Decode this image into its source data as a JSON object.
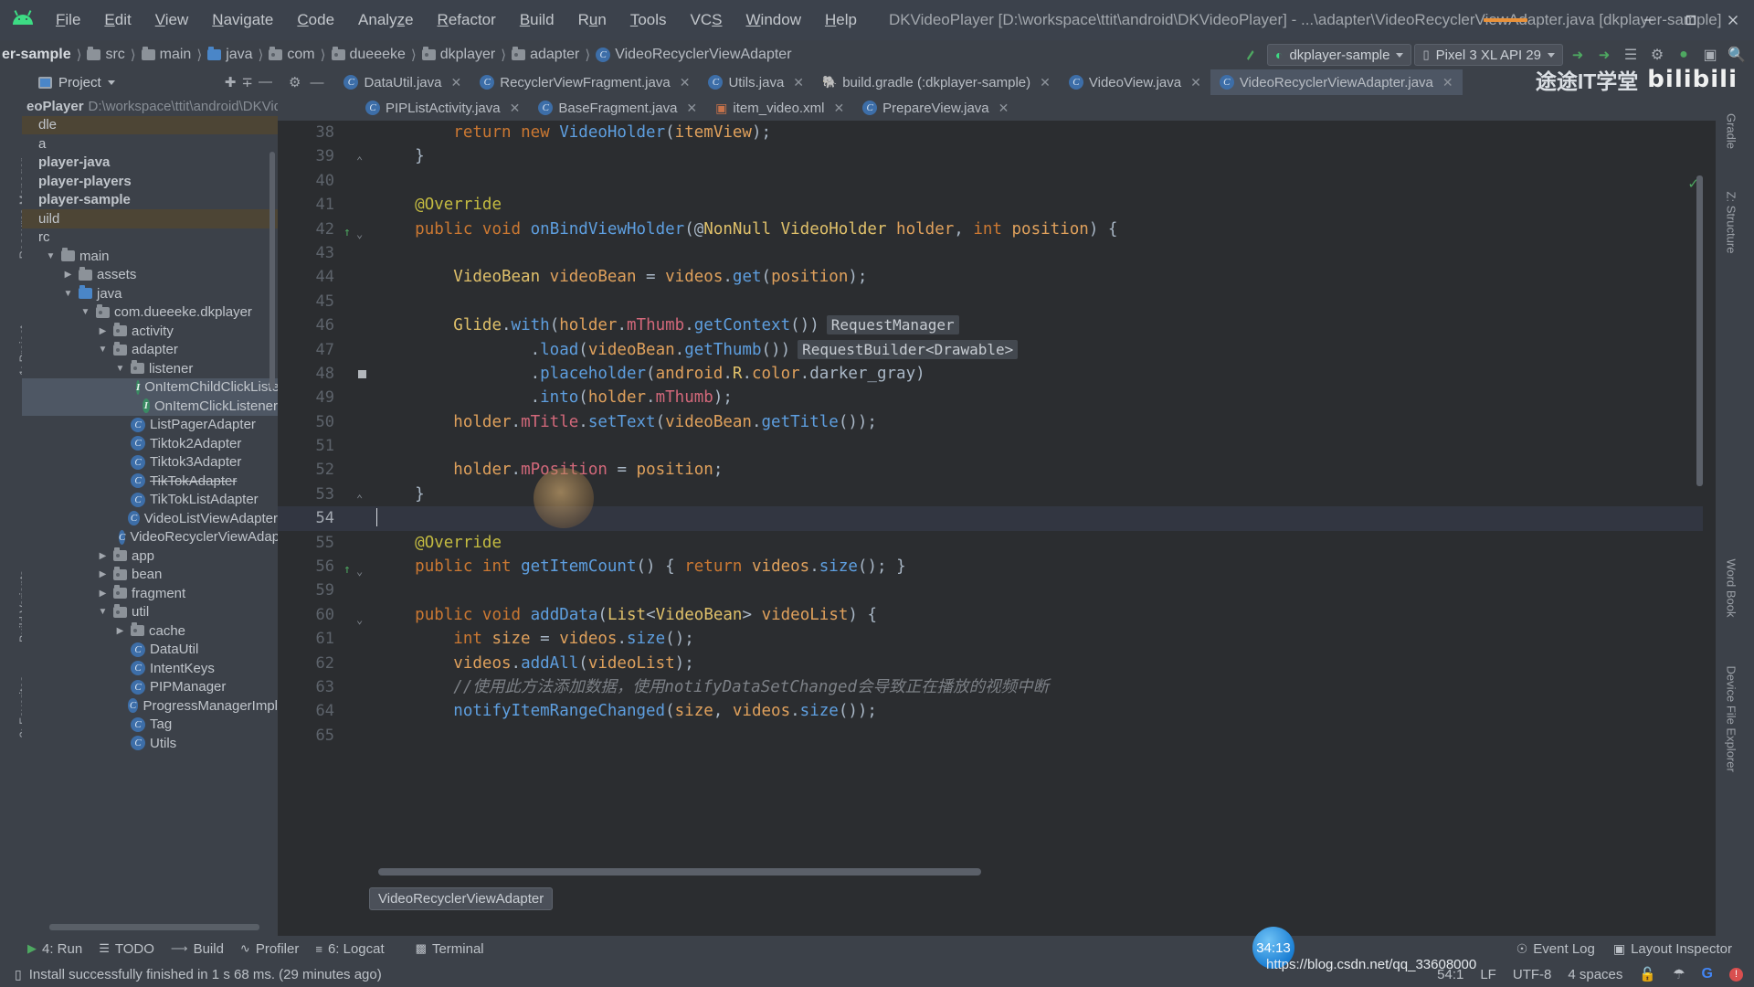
{
  "window": {
    "title": "DKVideoPlayer [D:\\workspace\\ttit\\android\\DKVideoPlayer] - ...\\adapter\\VideoRecyclerViewAdapter.java [dkplayer-sample]",
    "minimize": "–",
    "maximize": "❐",
    "close": "✕"
  },
  "menu": [
    {
      "label": "File"
    },
    {
      "label": "Edit"
    },
    {
      "label": "View"
    },
    {
      "label": "Navigate"
    },
    {
      "label": "Code"
    },
    {
      "label": "Analyze"
    },
    {
      "label": "Refactor"
    },
    {
      "label": "Build"
    },
    {
      "label": "Run"
    },
    {
      "label": "Tools"
    },
    {
      "label": "VCS"
    },
    {
      "label": "Window"
    },
    {
      "label": "Help"
    }
  ],
  "breadcrumbs": [
    {
      "label": "er-sample",
      "icon": "none",
      "bold": true
    },
    {
      "label": "src",
      "icon": "folder-grey"
    },
    {
      "label": "main",
      "icon": "folder-grey"
    },
    {
      "label": "java",
      "icon": "folder-blue"
    },
    {
      "label": "com",
      "icon": "package"
    },
    {
      "label": "dueeeke",
      "icon": "package"
    },
    {
      "label": "dkplayer",
      "icon": "package"
    },
    {
      "label": "adapter",
      "icon": "package"
    },
    {
      "label": "VideoRecyclerViewAdapter",
      "icon": "class"
    }
  ],
  "toolbar": {
    "run_config": "dkplayer-sample",
    "device": "Pixel 3 XL API 29",
    "icons": [
      "build-icon",
      "sync-icon",
      "avd-manager-icon",
      "sdk-manager-icon",
      "profiler-icon",
      "search-icon"
    ]
  },
  "project_panel": {
    "title": "Project",
    "tree": [
      {
        "label": "eoPlayer",
        "sub": "D:\\workspace\\ttit\\android\\DKVide",
        "indent": 0,
        "icon": "none",
        "bold": true,
        "twisty": ""
      },
      {
        "label": "dle",
        "indent": 0,
        "icon": "none",
        "twisty": "",
        "highlight": true
      },
      {
        "label": "a",
        "indent": 0,
        "icon": "none",
        "twisty": ""
      },
      {
        "label": "player-java",
        "indent": 0,
        "icon": "none",
        "twisty": "",
        "bold": true
      },
      {
        "label": "player-players",
        "indent": 0,
        "icon": "none",
        "twisty": "",
        "bold": true
      },
      {
        "label": "player-sample",
        "indent": 0,
        "icon": "none",
        "twisty": "",
        "bold": true
      },
      {
        "label": "uild",
        "indent": 0,
        "icon": "none",
        "twisty": "",
        "highlight": true
      },
      {
        "label": "rc",
        "indent": 0,
        "icon": "none",
        "twisty": ""
      },
      {
        "label": "main",
        "indent": 1,
        "icon": "folder-grey",
        "twisty": "▼"
      },
      {
        "label": "assets",
        "indent": 2,
        "icon": "folder-assets",
        "twisty": "▶"
      },
      {
        "label": "java",
        "indent": 2,
        "icon": "folder-blue",
        "twisty": "▼"
      },
      {
        "label": "com.dueeeke.dkplayer",
        "indent": 3,
        "icon": "package",
        "twisty": "▼"
      },
      {
        "label": "activity",
        "indent": 4,
        "icon": "package",
        "twisty": "▶"
      },
      {
        "label": "adapter",
        "indent": 4,
        "icon": "package",
        "twisty": "▼"
      },
      {
        "label": "listener",
        "indent": 5,
        "icon": "package",
        "twisty": "▼"
      },
      {
        "label": "OnItemChildClickListener",
        "indent": 6,
        "icon": "interface",
        "twisty": "",
        "selected": true
      },
      {
        "label": "OnItemClickListener",
        "indent": 6,
        "icon": "interface",
        "twisty": "",
        "selected": true
      },
      {
        "label": "ListPagerAdapter",
        "indent": 5,
        "icon": "class",
        "twisty": ""
      },
      {
        "label": "Tiktok2Adapter",
        "indent": 5,
        "icon": "class",
        "twisty": ""
      },
      {
        "label": "Tiktok3Adapter",
        "indent": 5,
        "icon": "class",
        "twisty": ""
      },
      {
        "label": "TikTokAdapter",
        "indent": 5,
        "icon": "class",
        "twisty": "",
        "strike": true
      },
      {
        "label": "TikTokListAdapter",
        "indent": 5,
        "icon": "class",
        "twisty": ""
      },
      {
        "label": "VideoListViewAdapter",
        "indent": 5,
        "icon": "class",
        "twisty": ""
      },
      {
        "label": "VideoRecyclerViewAdapter",
        "indent": 5,
        "icon": "class",
        "twisty": ""
      },
      {
        "label": "app",
        "indent": 4,
        "icon": "package",
        "twisty": "▶"
      },
      {
        "label": "bean",
        "indent": 4,
        "icon": "package",
        "twisty": "▶"
      },
      {
        "label": "fragment",
        "indent": 4,
        "icon": "package",
        "twisty": "▶"
      },
      {
        "label": "util",
        "indent": 4,
        "icon": "package",
        "twisty": "▼"
      },
      {
        "label": "cache",
        "indent": 5,
        "icon": "package",
        "twisty": "▶"
      },
      {
        "label": "DataUtil",
        "indent": 5,
        "icon": "class",
        "twisty": ""
      },
      {
        "label": "IntentKeys",
        "indent": 5,
        "icon": "class",
        "twisty": ""
      },
      {
        "label": "PIPManager",
        "indent": 5,
        "icon": "class",
        "twisty": ""
      },
      {
        "label": "ProgressManagerImpl",
        "indent": 5,
        "icon": "class",
        "twisty": ""
      },
      {
        "label": "Tag",
        "indent": 5,
        "icon": "class",
        "twisty": ""
      },
      {
        "label": "Utils",
        "indent": 5,
        "icon": "class",
        "twisty": ""
      }
    ]
  },
  "editor_tabs_row1": [
    {
      "label": "DataUtil.java",
      "icon": "class",
      "active": false
    },
    {
      "label": "RecyclerViewFragment.java",
      "icon": "class",
      "active": false
    },
    {
      "label": "Utils.java",
      "icon": "class",
      "active": false
    },
    {
      "label": "build.gradle (:dkplayer-sample)",
      "icon": "gradle",
      "active": false
    },
    {
      "label": "VideoView.java",
      "icon": "class",
      "active": false
    },
    {
      "label": "VideoRecyclerViewAdapter.java",
      "icon": "class",
      "active": true
    }
  ],
  "editor_tabs_row2": [
    {
      "label": "PIPListActivity.java",
      "icon": "class",
      "active": false
    },
    {
      "label": "BaseFragment.java",
      "icon": "class",
      "active": false
    },
    {
      "label": "item_video.xml",
      "icon": "xml",
      "active": false
    },
    {
      "label": "PrepareView.java",
      "icon": "class",
      "active": false
    }
  ],
  "code": {
    "first_line_number": 38,
    "cursor_line": 54,
    "lines": [
      {
        "n": 38,
        "text": "        return new VideoHolder(itemView);",
        "partial_top": true
      },
      {
        "n": 39,
        "text": "    }"
      },
      {
        "n": 40,
        "text": ""
      },
      {
        "n": 41,
        "text": "    @Override"
      },
      {
        "n": 42,
        "text": "    public void onBindViewHolder(@NonNull VideoHolder holder, int position) {"
      },
      {
        "n": 43,
        "text": ""
      },
      {
        "n": 44,
        "text": "        VideoBean videoBean = videos.get(position);"
      },
      {
        "n": 45,
        "text": ""
      },
      {
        "n": 46,
        "text": "        Glide.with(holder.mThumb.getContext())",
        "hint": "RequestManager"
      },
      {
        "n": 47,
        "text": "                .load(videoBean.getThumb())",
        "hint": "RequestBuilder<Drawable>"
      },
      {
        "n": 48,
        "text": "                .placeholder(android.R.color.darker_gray)"
      },
      {
        "n": 49,
        "text": "                .into(holder.mThumb);"
      },
      {
        "n": 50,
        "text": "        holder.mTitle.setText(videoBean.getTitle());"
      },
      {
        "n": 51,
        "text": ""
      },
      {
        "n": 52,
        "text": "        holder.mPosition = position;"
      },
      {
        "n": 53,
        "text": "    }"
      },
      {
        "n": 54,
        "text": ""
      },
      {
        "n": 55,
        "text": "    @Override"
      },
      {
        "n": 56,
        "text": "    public int getItemCount() { return videos.size(); }"
      },
      {
        "n": 59,
        "text": ""
      },
      {
        "n": 60,
        "text": "    public void addData(List<VideoBean> videoList) {"
      },
      {
        "n": 61,
        "text": "        int size = videos.size();"
      },
      {
        "n": 62,
        "text": "        videos.addAll(videoList);"
      },
      {
        "n": 63,
        "text": "        //使用此方法添加数据，使用notifyDataSetChanged会导致正在播放的视频中断"
      },
      {
        "n": 64,
        "text": "        notifyItemRangeChanged(size, videos.size());"
      },
      {
        "n": 65,
        "text": "",
        "partial_bottom": true
      }
    ],
    "tooltip": "VideoRecyclerViewAdapter"
  },
  "left_strip": [
    {
      "label": "Resource Manager"
    },
    {
      "label": "1: Project"
    },
    {
      "label": "Build Variants"
    },
    {
      "label": "2: Favorites"
    }
  ],
  "right_strip": [
    {
      "label": "Gradle"
    },
    {
      "label": "Z: Structure"
    },
    {
      "label": "Word Book"
    },
    {
      "label": "Device File Explorer"
    }
  ],
  "toolwindow_bar": {
    "items": [
      {
        "label": "4: Run",
        "icon": "run-icon"
      },
      {
        "label": "TODO",
        "icon": "todo-icon"
      },
      {
        "label": "Build",
        "icon": "build-icon"
      },
      {
        "label": "Profiler",
        "icon": "profiler-icon"
      },
      {
        "label": "6: Logcat",
        "icon": "logcat-icon"
      },
      {
        "label": "Terminal",
        "icon": "terminal-icon"
      }
    ],
    "right": [
      {
        "label": "Event Log",
        "icon": "event-log-icon"
      },
      {
        "label": "Layout Inspector",
        "icon": "layout-inspector-icon"
      }
    ]
  },
  "statusbar": {
    "message": "Install successfully finished in 1 s 68 ms. (29 minutes ago)",
    "caret_position": "54:1",
    "line_separator": "LF",
    "encoding": "UTF-8",
    "indent": "4 spaces",
    "icons": [
      "lock-icon",
      "hat-icon",
      "google-icon",
      "notification-icon"
    ]
  },
  "overlay": {
    "watermark": "途途IT学堂",
    "brand": "bilibili",
    "timer_badge": "34:13",
    "csdn_url": "https://blog.csdn.net/qq_33608000"
  },
  "colors": {
    "accent_orange": "#e8913a",
    "green": "#3ddc84",
    "selection": "#4e5764",
    "editor_bg": "#2b2d30",
    "panel_bg": "#3c4149"
  }
}
